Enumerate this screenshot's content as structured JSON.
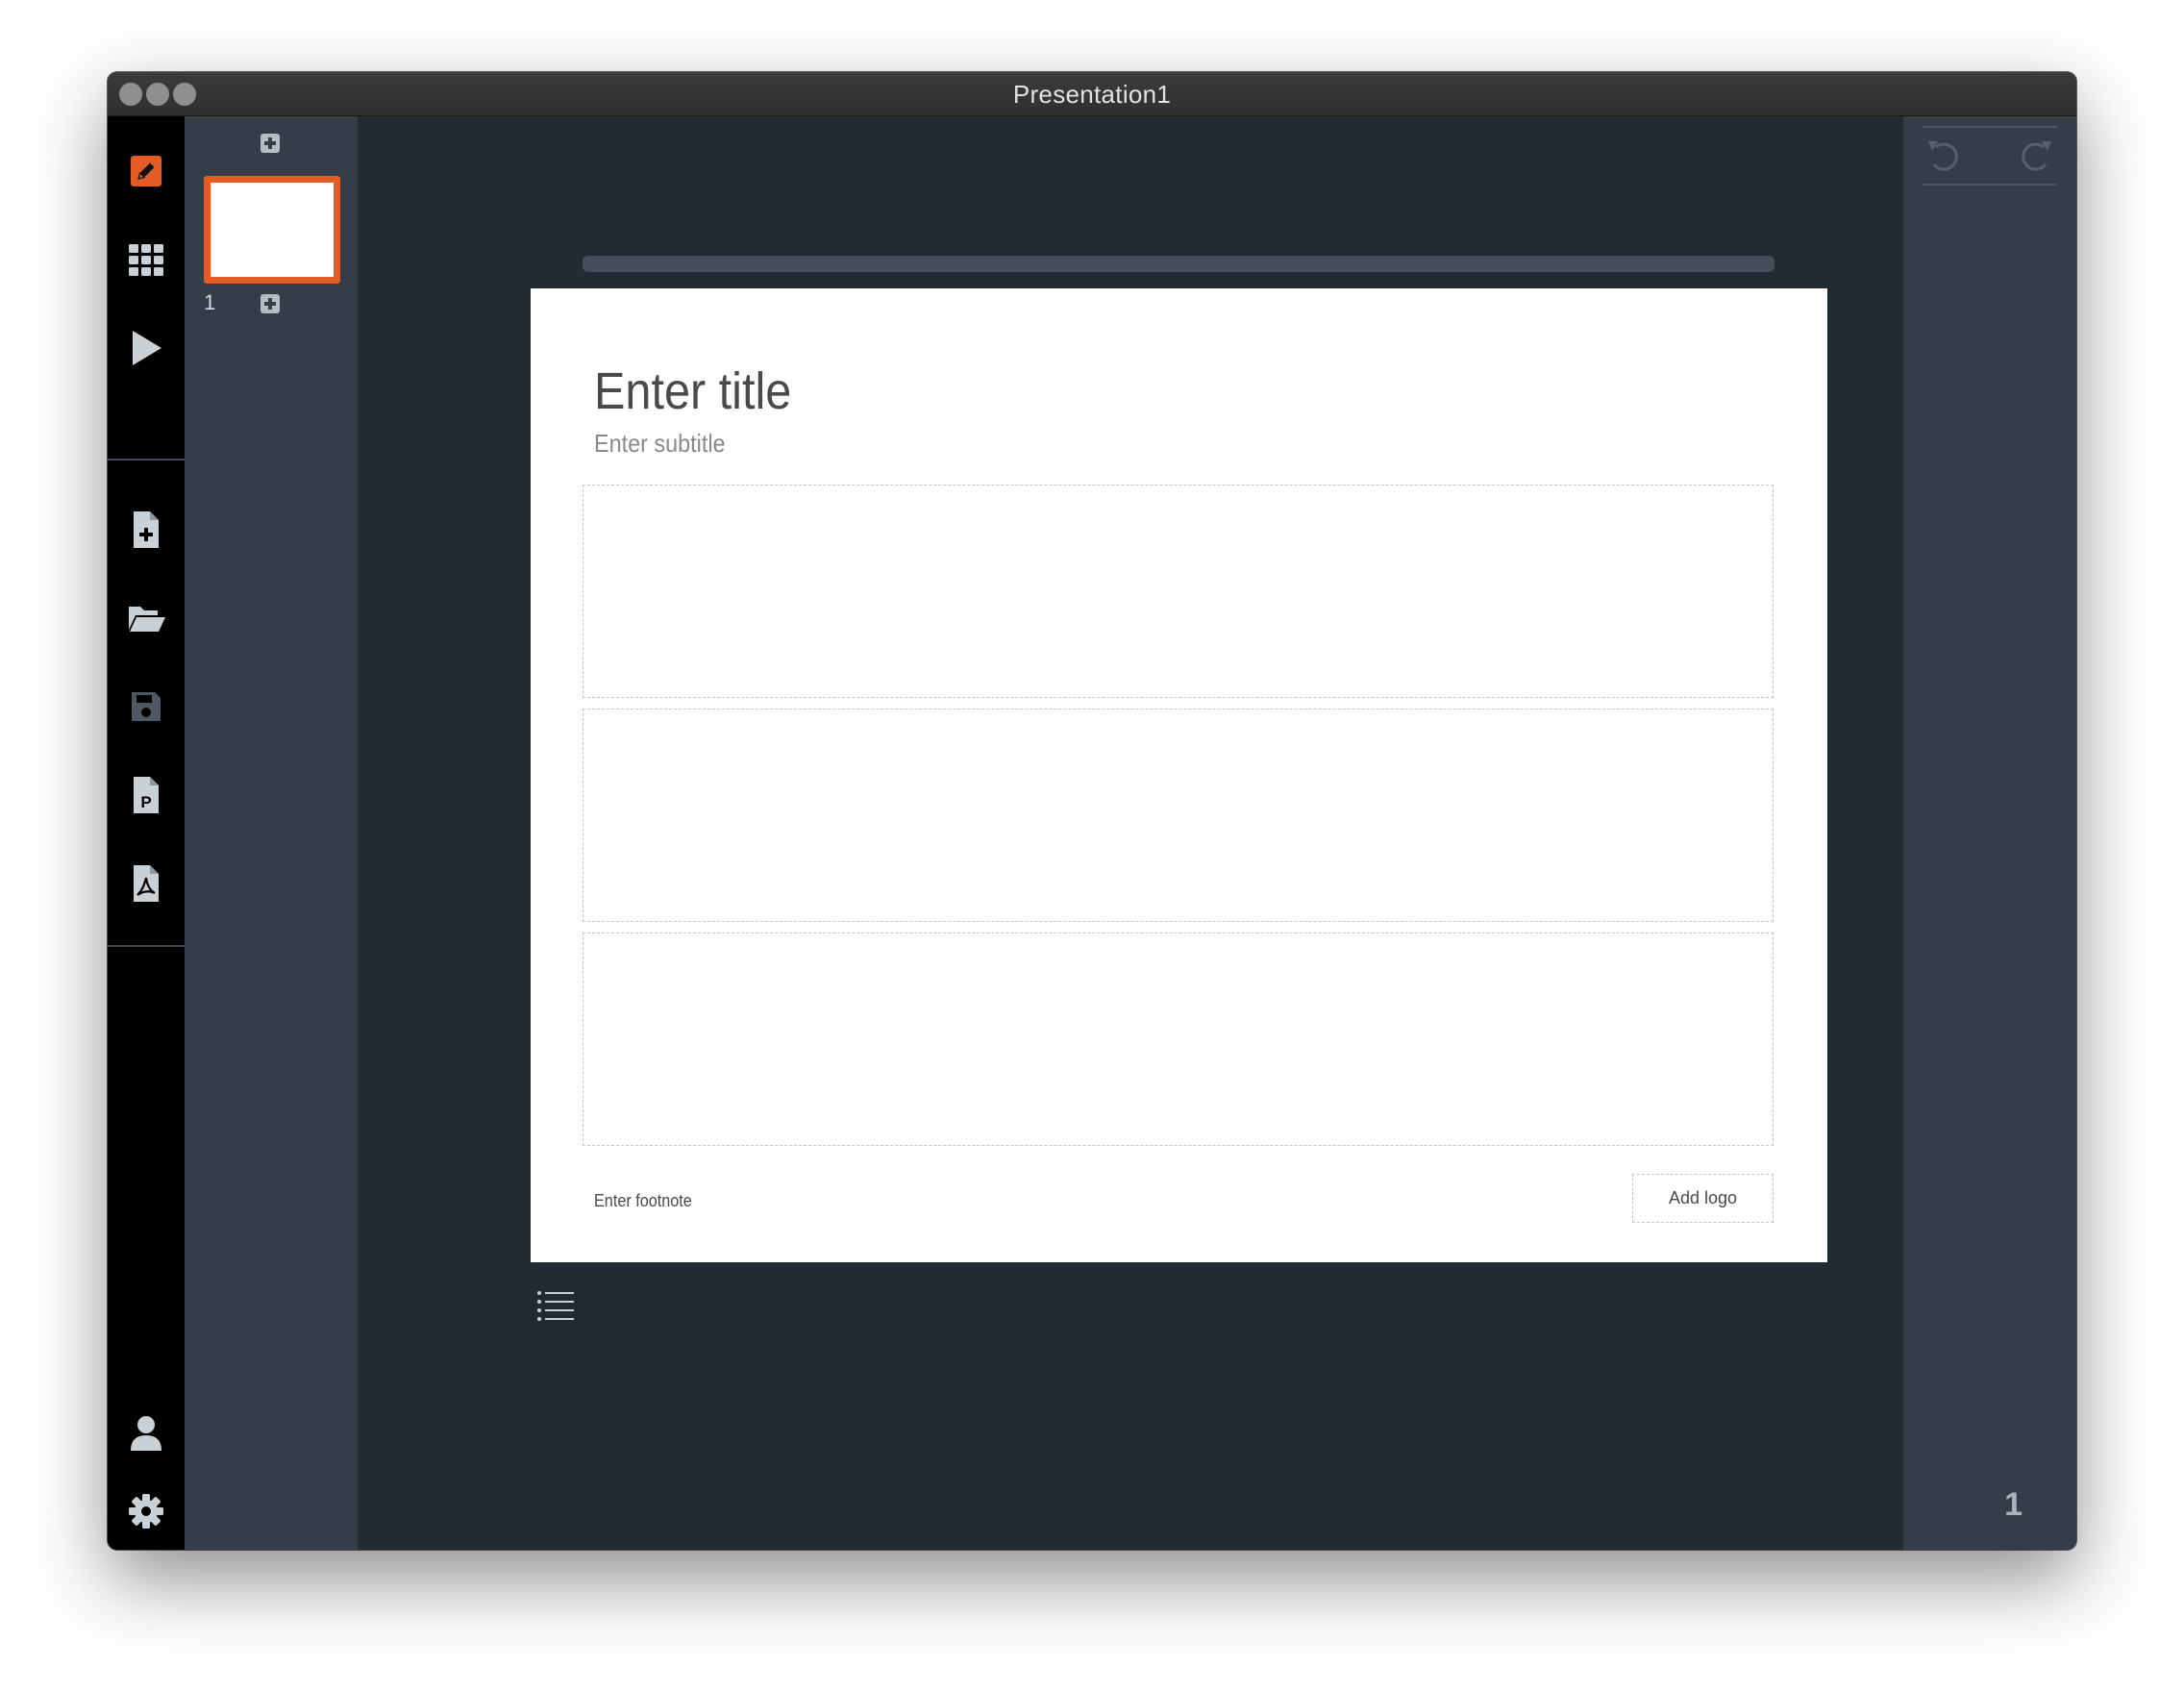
{
  "window": {
    "title": "Presentation1"
  },
  "rail": {
    "icons": [
      "edit-icon",
      "grid-icon",
      "play-icon",
      "new-file-icon",
      "open-folder-icon",
      "save-icon",
      "export-pptx-icon",
      "export-pdf-icon",
      "user-icon",
      "settings-icon"
    ],
    "accent_color": "#e35b25"
  },
  "slides_panel": {
    "slide_numbers": [
      "1"
    ]
  },
  "slide": {
    "title": "Enter title",
    "subtitle": "Enter subtitle",
    "footnote": "Enter footnote",
    "logo_label": "Add logo"
  },
  "right_panel": {
    "icons": [
      "undo-icon",
      "redo-icon"
    ],
    "page_number": "1"
  }
}
